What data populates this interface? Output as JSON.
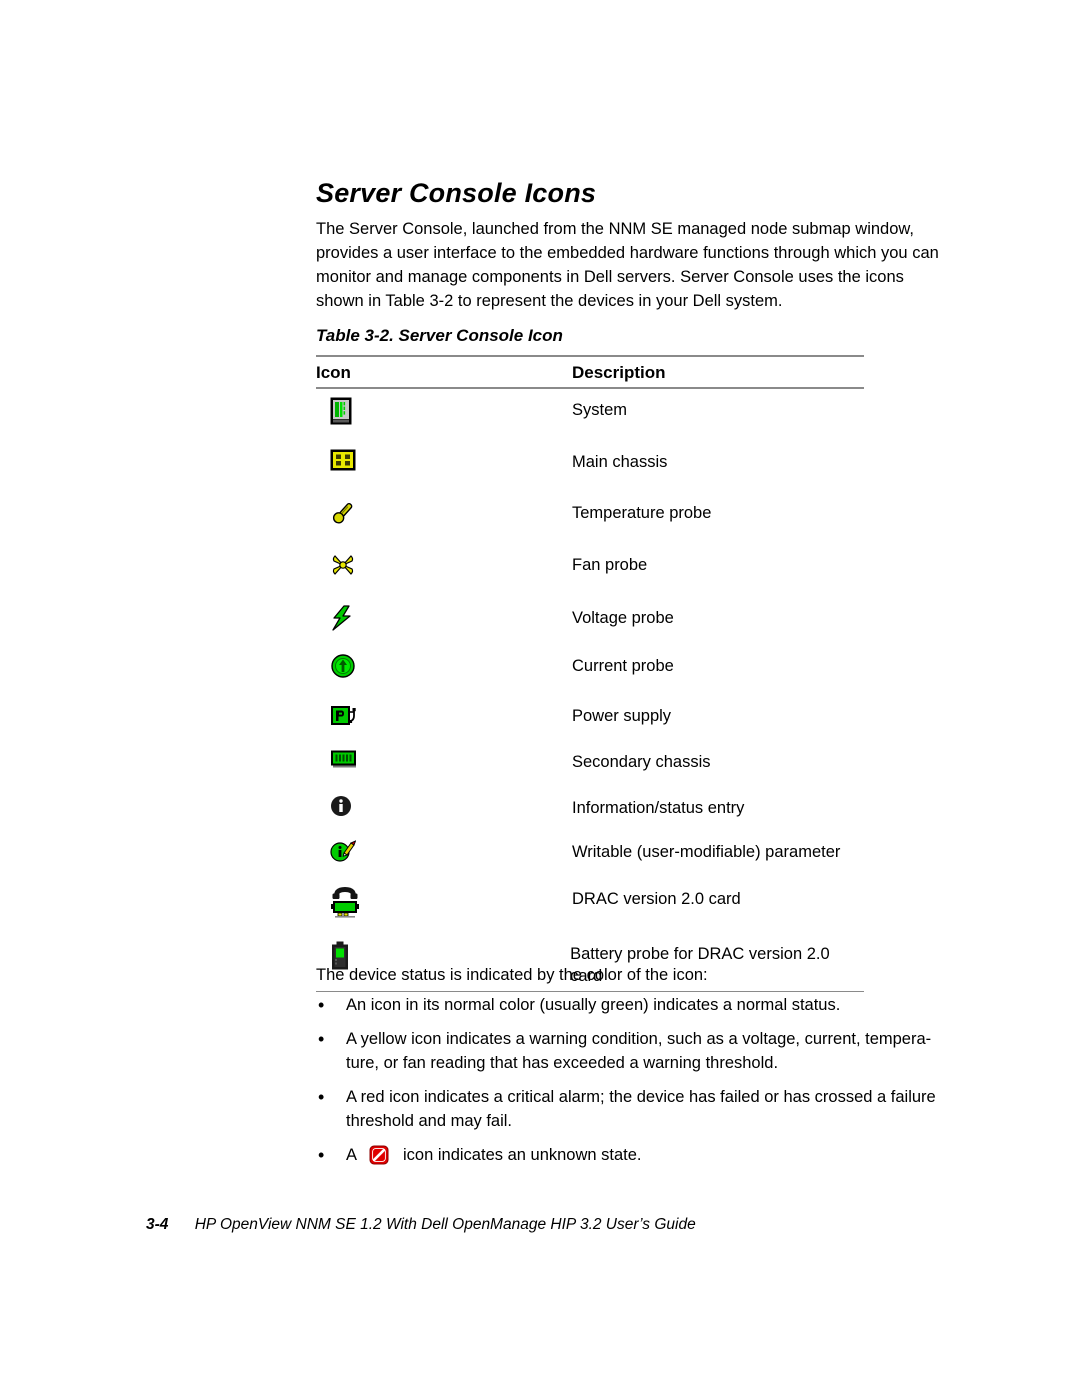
{
  "page": {
    "heading": "Server Console Icons",
    "intro_lines": [
      "The Server Console, launched from the NNM SE managed node submap window,",
      "provides a user interface to the embedded hardware functions through which you can",
      "monitor and manage components in Dell servers. Server Console uses the icons",
      "shown in Table 3-2 to represent the devices in your Dell system."
    ],
    "table_caption": "Table 3-2.  Server Console Icon",
    "table": {
      "headers": {
        "icon": "Icon",
        "description": "Description"
      },
      "rows": [
        {
          "icon_name": "system-tower-icon",
          "description": "System"
        },
        {
          "icon_name": "main-chassis-icon",
          "description": "Main chassis"
        },
        {
          "icon_name": "temperature-probe-icon",
          "description": "Temperature probe"
        },
        {
          "icon_name": "fan-probe-icon",
          "description": "Fan probe"
        },
        {
          "icon_name": "voltage-probe-icon",
          "description": "Voltage probe"
        },
        {
          "icon_name": "current-probe-icon",
          "description": "Current probe"
        },
        {
          "icon_name": "power-supply-icon",
          "description": "Power supply"
        },
        {
          "icon_name": "secondary-chassis-icon",
          "description": "Secondary chassis"
        },
        {
          "icon_name": "information-status-icon",
          "description": "Information/status entry"
        },
        {
          "icon_name": "writable-parameter-icon",
          "description": "Writable (user-modifiable) parameter"
        },
        {
          "icon_name": "drac-card-icon",
          "description": "DRAC version 2.0 card"
        },
        {
          "icon_name": "battery-probe-icon",
          "description": "Battery probe for DRAC version 2.0 card"
        }
      ]
    },
    "status_intro": "The device status is indicated by the color of the icon:",
    "bullets": [
      {
        "marker": "•",
        "lines": [
          "An icon in its normal color (usually green) indicates a normal status."
        ]
      },
      {
        "marker": "•",
        "lines": [
          "A yellow icon indicates a warning condition, such as a voltage, current, tempera-",
          "ture, or fan reading that has exceeded a warning threshold."
        ]
      },
      {
        "marker": "•",
        "lines": [
          "A red icon indicates a critical alarm; the device has failed or has crossed a failure",
          "threshold and may fail."
        ]
      },
      {
        "marker": "•",
        "icon_name": "unknown-state-icon",
        "prefix": "A",
        "suffix": "icon indicates an unknown state."
      }
    ],
    "footer": {
      "folio": "3-4",
      "title": "HP OpenView NNM SE 1.2 With Dell OpenManage HIP 3.2 User’s Guide"
    },
    "colors": {
      "normal_green": "#00cc00",
      "warning_yellow": "#e8e800",
      "critical_red": "#e00000",
      "rule_gray": "#8a8a8a",
      "text_black": "#000000"
    }
  }
}
